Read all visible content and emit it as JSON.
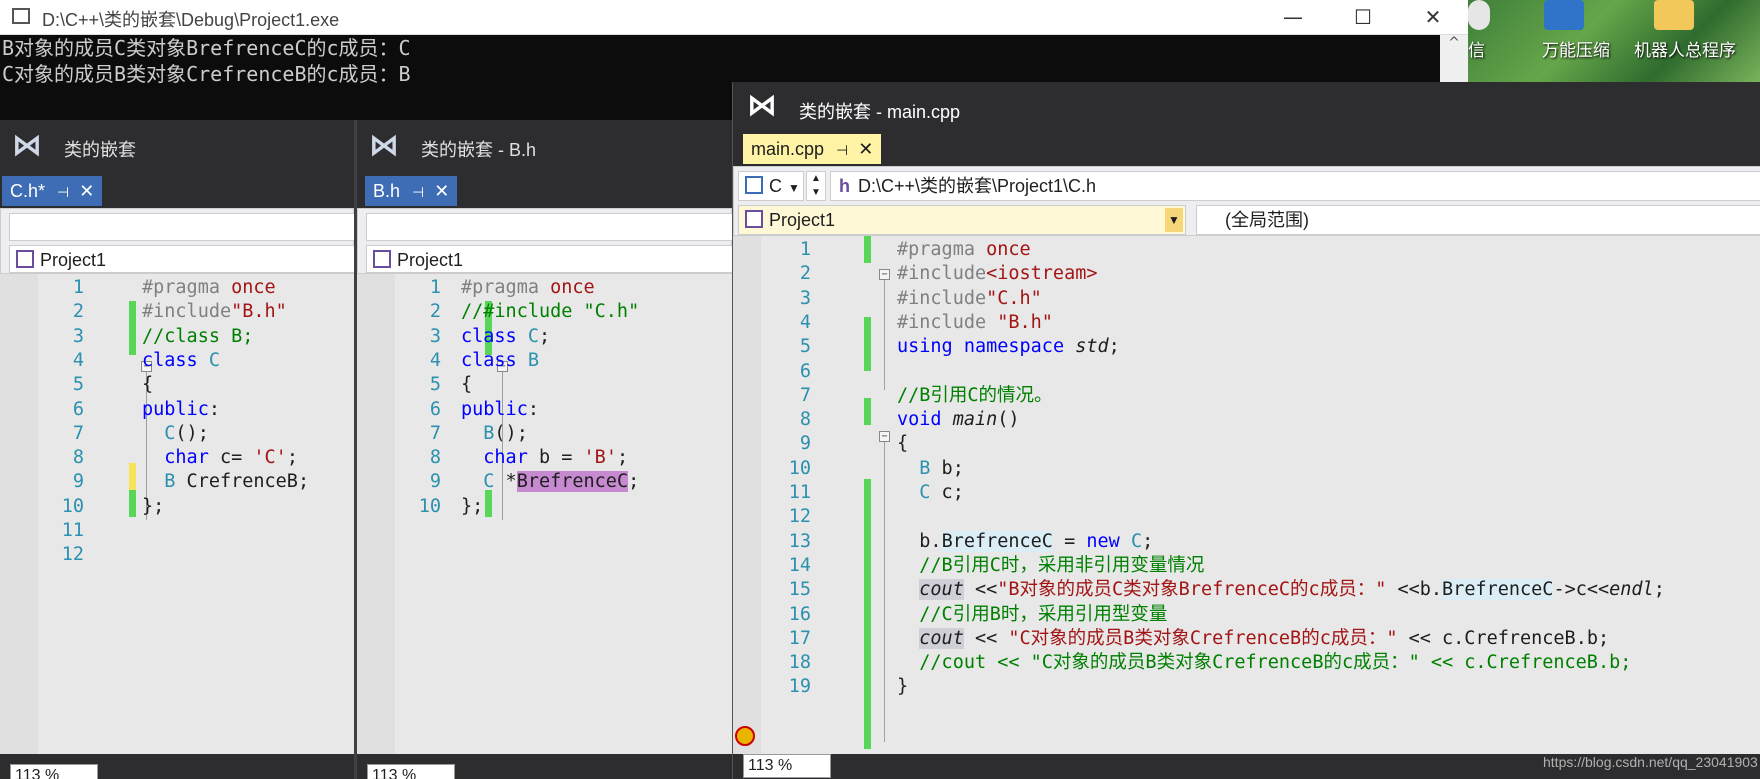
{
  "console": {
    "title": "D:\\C++\\类的嵌套\\Debug\\Project1.exe",
    "minimize": "—",
    "maximize": "☐",
    "close": "✕",
    "lines": [
      "B对象的成员C类对象BrefrenceC的c成员：C",
      "C对象的成员B类对象CrefrenceB的c成员：B"
    ],
    "scroll_up": "^"
  },
  "desktop": {
    "items": [
      "信",
      "万能压缩",
      "机器人总程序"
    ]
  },
  "win_c": {
    "title": "类的嵌套",
    "tab": "C.h*",
    "pin": "⊣",
    "close": "✕",
    "project": "Project1",
    "zoom": "113 %"
  },
  "win_b": {
    "title": "类的嵌套 - B.h",
    "tab": "B.h",
    "pin": "⊣",
    "close": "✕",
    "project": "Project1",
    "zoom": "113 %"
  },
  "win_main": {
    "title": "类的嵌套 - main.cpp",
    "tab": "main.cpp",
    "pin": "⊣",
    "close": "✕",
    "nav_small": "C",
    "path": "D:\\C++\\类的嵌套\\Project1\\C.h",
    "project": "Project1",
    "scope": "(全局范围)",
    "zoom": "113 %",
    "watermark": "https://blog.csdn.net/qq_23041903"
  },
  "code_c": [
    {
      "n": "1",
      "t": "#pragma once"
    },
    {
      "n": "2",
      "t": "#include\"B.h\""
    },
    {
      "n": "3",
      "t": "//class B;"
    },
    {
      "n": "4",
      "t": "class C"
    },
    {
      "n": "5",
      "t": "{"
    },
    {
      "n": "6",
      "t": "public:"
    },
    {
      "n": "7",
      "t": "  C();"
    },
    {
      "n": "8",
      "t": "  char c= 'C';"
    },
    {
      "n": "9",
      "t": "  B CrefrenceB;"
    },
    {
      "n": "10",
      "t": "};"
    },
    {
      "n": "11",
      "t": ""
    },
    {
      "n": "12",
      "t": ""
    }
  ],
  "code_b": [
    {
      "n": "1",
      "t": "#pragma once"
    },
    {
      "n": "2",
      "t": "//#include \"C.h\""
    },
    {
      "n": "3",
      "t": "class C;"
    },
    {
      "n": "4",
      "t": "class B"
    },
    {
      "n": "5",
      "t": "{"
    },
    {
      "n": "6",
      "t": "public:"
    },
    {
      "n": "7",
      "t": "  B();"
    },
    {
      "n": "8",
      "t": "  char b = 'B';"
    },
    {
      "n": "9",
      "t": "  C *BrefrenceC;"
    },
    {
      "n": "10",
      "t": "};"
    }
  ],
  "code_main": [
    {
      "n": "1",
      "t": "#pragma once"
    },
    {
      "n": "2",
      "t": "#include<iostream>"
    },
    {
      "n": "3",
      "t": "#include\"C.h\""
    },
    {
      "n": "4",
      "t": "#include \"B.h\""
    },
    {
      "n": "5",
      "t": "using namespace std;"
    },
    {
      "n": "6",
      "t": ""
    },
    {
      "n": "7",
      "t": "//B引用C的情况。"
    },
    {
      "n": "8",
      "t": "void main()"
    },
    {
      "n": "9",
      "t": "{"
    },
    {
      "n": "10",
      "t": "  B b;"
    },
    {
      "n": "11",
      "t": "  C c;"
    },
    {
      "n": "12",
      "t": ""
    },
    {
      "n": "13",
      "t": "  b.BrefrenceC = new C;"
    },
    {
      "n": "14",
      "t": "  //B引用C时，采用非引用变量情况"
    },
    {
      "n": "15",
      "t": "  cout <<\"B对象的成员C类对象BrefrenceC的c成员：\" <<b.BrefrenceC->c<<endl;"
    },
    {
      "n": "16",
      "t": "  //C引用B时，采用引用型变量"
    },
    {
      "n": "17",
      "t": "  cout << \"C对象的成员B类对象CrefrenceB的c成员：\" << c.CrefrenceB.b;"
    },
    {
      "n": "18",
      "t": "  //cout << \"C对象的成员B类对象CrefrenceB的c成员：\" << c.CrefrenceB.b;"
    },
    {
      "n": "19",
      "t": "}"
    }
  ]
}
